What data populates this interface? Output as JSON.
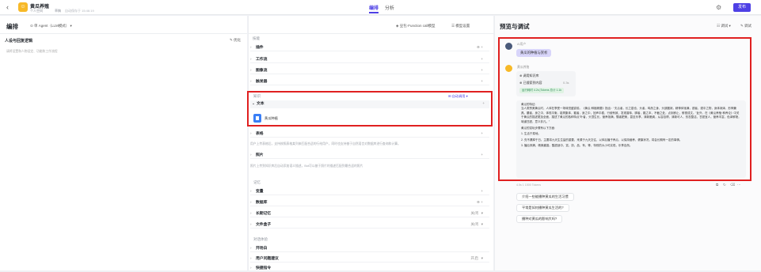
{
  "header": {
    "bot_name": "黄瓜养殖",
    "meta1": "个人空间",
    "meta2": "草稿",
    "meta3": "自动保存于 15:46:19",
    "tabs": [
      "编排",
      "分析"
    ],
    "publish_label": "发布"
  },
  "left": {
    "title": "编排",
    "mode": "单 Agent（LLM模式）",
    "section_title": "人设与回复逻辑",
    "optimize": "优化",
    "placeholder": "请将设置和人物设定、功能和工作流程"
  },
  "middle": {
    "model_label": "豆包·Function call模型",
    "settings_label": "模型设置",
    "skills_group": "技能",
    "skills": [
      "插件",
      "工作流",
      "图像流",
      "触发器"
    ],
    "knowledge_group": "知识",
    "knowledge_auto": "自动调用",
    "text_label": "文本",
    "doc_name": "黄瓜种植",
    "table_label": "表格",
    "table_hint": "用户上传表格后，支持按照表格某列来匹配合适的行给用户，同时也支持基于自然语言对数据库进行查询和计算。",
    "photo_label": "照片",
    "photo_hint": "照片上传到知识库后自动添加语义描述，Bot可以基于照片的描述匹配到最合适的照片",
    "memory_group": "记忆",
    "memory": [
      {
        "label": "变量",
        "right": ""
      },
      {
        "label": "数据库",
        "right": ""
      },
      {
        "label": "长期记忆",
        "right": "关闭"
      },
      {
        "label": "文件盒子",
        "right": "关闭"
      }
    ],
    "dialog_group": "对话体验",
    "dialog": [
      {
        "label": "开场白",
        "right": ""
      },
      {
        "label": "用户问题建议",
        "right": "开启"
      },
      {
        "label": "快捷指令",
        "right": ""
      }
    ]
  },
  "right": {
    "title": "预览与调试",
    "debug": "调试",
    "clear": "调试",
    "user_name": "AI用户",
    "user_msg": "黄瓜的种植与赏析",
    "bot_name": "黄瓜养殖",
    "call1": "调用知识库",
    "call2": "已搜索到内容",
    "call_time": "0.3s",
    "tokens": "运行耗时 4.2s  |Tokens 总计 1.1k",
    "answer_title": "黄瓜的特征:",
    "answer_p1": "当人类赞美黄瓜时，人体在享受一场味觉盛宴前。《黄瓜·种植精要》指出：“夫瓜者，长之甚也，头者，鸣然之身，头部圆润，精神体饱满，颈者，颈中之物，身体润泽，形神兼具。腰者，身之中，体现平衡，能再集体，瓤者，身之中，回声平稳，行使有致，发现香味，脚者，瓤之本，不截之处，点到即止，俯视成文。”此外，在《黄瓜养殖·种养论》中关于黄瓜的描述更加全面，描述了黄瓜的各种特点“叶者，头顶生长，营养饱满，瓢者肥美，甚至乐享，清新脆爽，从容自得，清新可人，形态整洁，甘甜宜人，营养丰富，色泽鲜艳，味道甘甜，意义非凡。”",
    "answer_p2": "黄瓜的赏玩步骤有以下方面:",
    "answer_list": [
      "1. 生活于菜地。",
      "2. 充不漏掉于日。主要将九天生生盐的重要，来源于九天交往，以体后播子养瓜，以保持营养，健康状况，将会长期有一定的事情。",
      "3. 播后采摘，精美酱香。酸甜适中，赏，奶，品，有，等，特别的大小可实现，乐享自然。"
    ],
    "token_info": "4.5s  1  1500 Tokens",
    "suggestions": [
      "介绍一些能播种黄瓜的生活习惯",
      "平常是如何播种黄瓜生活的?",
      "播种对黄瓜的影响大吗?"
    ]
  }
}
